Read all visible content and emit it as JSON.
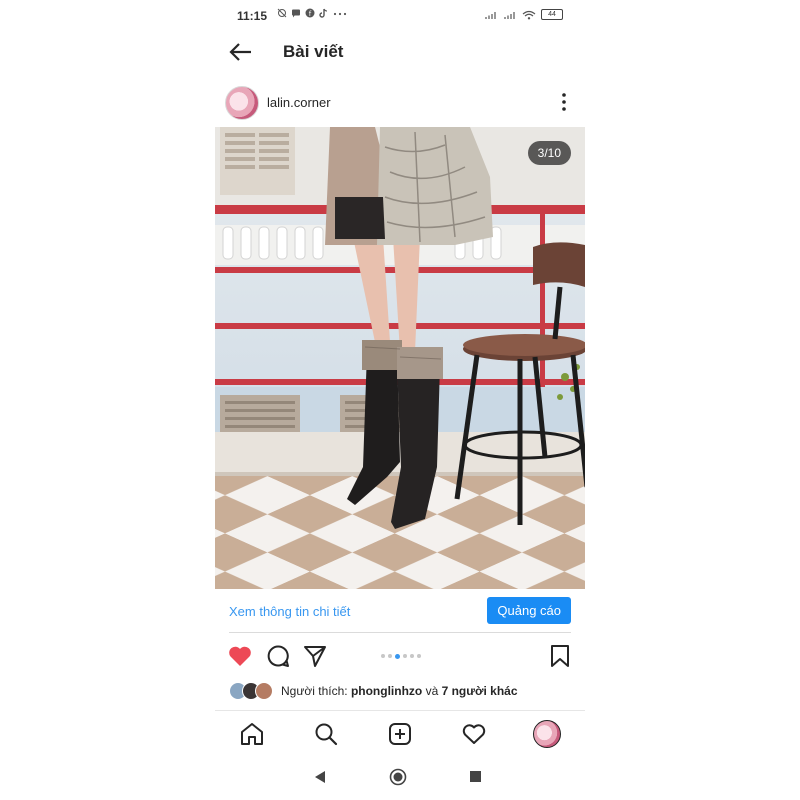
{
  "status_bar": {
    "time": "11:15",
    "battery": "44",
    "left_icons": [
      "alarm-off-icon",
      "chat-icon",
      "facebook-icon",
      "tiktok-icon",
      "more-dots-icon"
    ],
    "right_icons": [
      "signal-icon",
      "signal-icon",
      "wifi-icon",
      "battery-icon"
    ]
  },
  "header": {
    "title": "Bài viết",
    "back_icon": "arrow-left-icon"
  },
  "post": {
    "username": "lalin.corner",
    "image_counter": "3/10",
    "cta_link": "Xem thông tin chi tiết",
    "cta_button": "Quảng cáo",
    "carousel": {
      "count": 6,
      "active_index": 2
    },
    "liked": true
  },
  "likes": {
    "prefix": "Người thích: ",
    "user": "phonglinhzo",
    "connector": " và ",
    "others": "7 người khác"
  },
  "bottom_nav": [
    "home-icon",
    "search-icon",
    "add-post-icon",
    "activity-heart-icon",
    "profile-avatar"
  ],
  "system_nav": [
    "back-triangle-icon",
    "home-circle-icon",
    "recents-square-icon"
  ],
  "colors": {
    "accent": "#3897f0",
    "cta_button": "#1a8cf4",
    "heart": "#ed4956",
    "text": "#262626"
  }
}
